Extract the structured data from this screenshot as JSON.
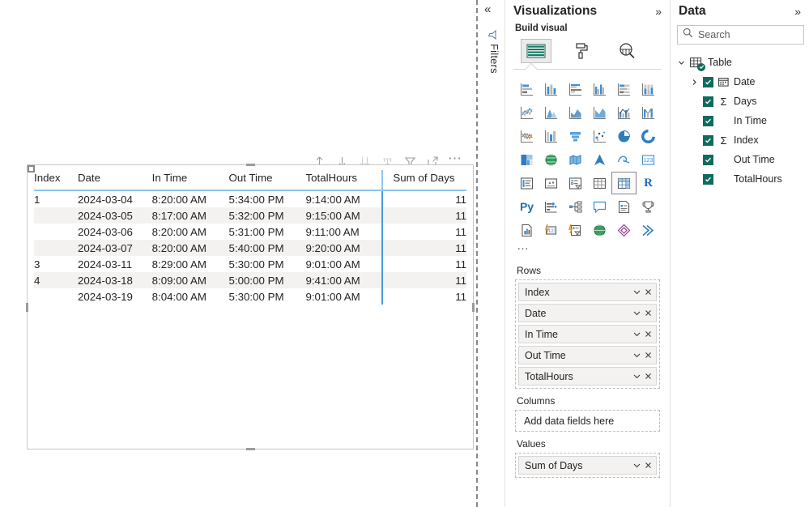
{
  "canvas": {
    "visual_toolbar": [
      {
        "name": "drill-up-icon",
        "title": "Drill up"
      },
      {
        "name": "drill-down-arrow-icon",
        "title": "Go to the next level in the hierarchy"
      },
      {
        "name": "expand-all-down-icon",
        "title": "Expand all down one level in the hierarchy"
      },
      {
        "name": "drill-mode-icon",
        "title": "Drill on"
      },
      {
        "name": "filter-icon",
        "title": "Filters"
      },
      {
        "name": "focus-mode-icon",
        "title": "Focus mode"
      },
      {
        "name": "more-options-icon",
        "title": "More options"
      }
    ]
  },
  "matrix": {
    "columns": [
      "Index",
      "Date",
      "In Time",
      "Out Time",
      "TotalHours",
      "Sum of Days"
    ],
    "rows": [
      {
        "index": "1",
        "date": "2024-03-04",
        "in_time": "8:20:00 AM",
        "out_time": "5:34:00 PM",
        "total_hours": "9:14:00 AM",
        "sum_of_days": "11"
      },
      {
        "index": "",
        "date": "2024-03-05",
        "in_time": "8:17:00 AM",
        "out_time": "5:32:00 PM",
        "total_hours": "9:15:00 AM",
        "sum_of_days": "11"
      },
      {
        "index": "",
        "date": "2024-03-06",
        "in_time": "8:20:00 AM",
        "out_time": "5:31:00 PM",
        "total_hours": "9:11:00 AM",
        "sum_of_days": "11"
      },
      {
        "index": "",
        "date": "2024-03-07",
        "in_time": "8:20:00 AM",
        "out_time": "5:40:00 PM",
        "total_hours": "9:20:00 AM",
        "sum_of_days": "11"
      },
      {
        "index": "3",
        "date": "2024-03-11",
        "in_time": "8:29:00 AM",
        "out_time": "5:30:00 PM",
        "total_hours": "9:01:00 AM",
        "sum_of_days": "11"
      },
      {
        "index": "4",
        "date": "2024-03-18",
        "in_time": "8:09:00 AM",
        "out_time": "5:00:00 PM",
        "total_hours": "9:41:00 AM",
        "sum_of_days": "11"
      },
      {
        "index": "",
        "date": "2024-03-19",
        "in_time": "8:04:00 AM",
        "out_time": "5:30:00 PM",
        "total_hours": "9:01:00 AM",
        "sum_of_days": "11"
      }
    ]
  },
  "filters_rail": {
    "collapse_glyph": "«",
    "label": "Filters"
  },
  "visualizations": {
    "title": "Visualizations",
    "expand_glyph": "»",
    "build_visual_label": "Build visual",
    "tabs": [
      {
        "name": "build-visual-tab",
        "selected": true
      },
      {
        "name": "format-visual-tab",
        "selected": false
      },
      {
        "name": "analytics-tab",
        "selected": false
      }
    ],
    "gallery": [
      "stacked-bar-chart-icon",
      "stacked-column-chart-icon",
      "clustered-bar-chart-icon",
      "clustered-column-chart-icon",
      "hundred-percent-stacked-bar-chart-icon",
      "hundred-percent-stacked-column-chart-icon",
      "line-chart-icon",
      "area-chart-icon",
      "stacked-area-chart-icon",
      "line-and-stacked-column-chart-icon",
      "line-and-clustered-column-chart-icon",
      "ribbon-chart-icon",
      "waterfall-chart-icon",
      "funnel-chart-icon",
      "scatter-chart-icon",
      "pie-chart-icon",
      "donut-chart-icon",
      "treemap-icon",
      "map-icon",
      "filled-map-icon",
      "azure-map-icon",
      "arcgis-map-icon",
      "shape-map-icon",
      "card-icon",
      "multi-row-card-icon",
      "kpi-icon",
      "slicer-icon",
      "table-icon",
      "matrix-icon",
      "r-script-visual-icon",
      "python-visual-icon",
      "key-influencers-icon",
      "decomposition-tree-icon",
      "qna-icon",
      "smart-narrative-icon",
      "metrics-icon",
      "paginated-report-icon",
      "power-apps-icon",
      "power-automate-icon",
      "globe-visual-icon",
      "diamond-visual-icon",
      "chevron-visual-icon"
    ],
    "selected_gallery_icon": "matrix-icon",
    "more_visuals_glyph": "…",
    "wells": [
      {
        "name": "rows-well",
        "title": "Rows",
        "fields": [
          "Index",
          "Date",
          "In Time",
          "Out Time",
          "TotalHours"
        ]
      },
      {
        "name": "columns-well",
        "title": "Columns",
        "placeholder": "Add data fields here",
        "fields": []
      },
      {
        "name": "values-well",
        "title": "Values",
        "fields": [
          "Sum of Days"
        ]
      }
    ]
  },
  "data_pane": {
    "title": "Data",
    "expand_glyph": "»",
    "search_placeholder": "Search",
    "table": {
      "name": "Table",
      "expanded": true,
      "fields": [
        {
          "label": "Date",
          "icon": "calendar-icon",
          "expandable": true,
          "checked": true
        },
        {
          "label": "Days",
          "icon": "sigma-icon",
          "expandable": false,
          "checked": true
        },
        {
          "label": "In Time",
          "icon": "none",
          "expandable": false,
          "checked": true
        },
        {
          "label": "Index",
          "icon": "sigma-icon",
          "expandable": false,
          "checked": true
        },
        {
          "label": "Out Time",
          "icon": "none",
          "expandable": false,
          "checked": true
        },
        {
          "label": "TotalHours",
          "icon": "none",
          "expandable": false,
          "checked": true
        }
      ]
    }
  },
  "colors": {
    "accent_blue": "#4a9ada",
    "header_underline": "#8ec5f0",
    "band": "#f3f2f1",
    "teal_check": "#0f6b5c",
    "icon_gray": "#8a8886"
  }
}
